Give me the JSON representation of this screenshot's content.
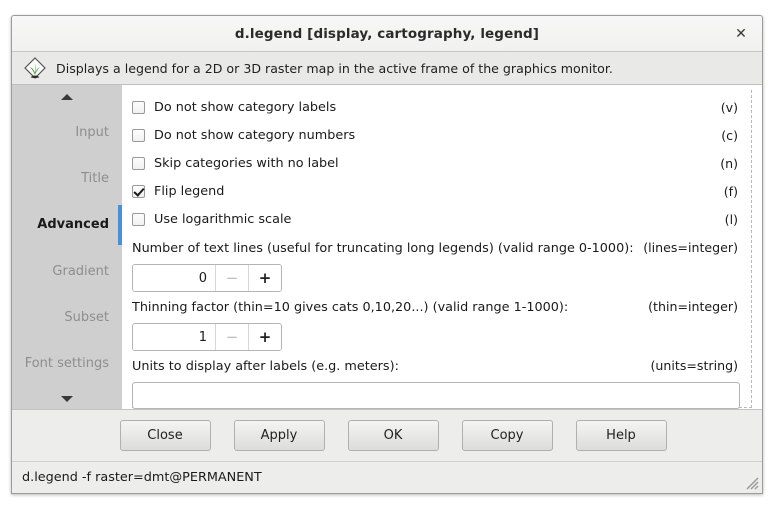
{
  "window": {
    "title": "d.legend [display, cartography, legend]",
    "close_label": "✕",
    "description": "Displays a legend for a 2D or 3D raster map in the active frame of the graphics monitor.",
    "logo_icon": "grass-gis-logo-icon"
  },
  "sidebar": {
    "scroll_up_icon": "chevron-up-icon",
    "scroll_down_icon": "chevron-down-icon",
    "selected": "Advanced",
    "accent_color": "#4a90d9",
    "items": [
      {
        "label": "Input",
        "selected": false
      },
      {
        "label": "Title",
        "selected": false
      },
      {
        "label": "Advanced",
        "selected": true
      },
      {
        "label": "Gradient",
        "selected": false
      },
      {
        "label": "Subset",
        "selected": false
      },
      {
        "label": "Font settings",
        "selected": false
      }
    ]
  },
  "advanced": {
    "checkboxes": [
      {
        "label": "Do not show category labels",
        "hint": "(v)",
        "checked": false
      },
      {
        "label": "Do not show category numbers",
        "hint": "(c)",
        "checked": false
      },
      {
        "label": "Skip categories with no label",
        "hint": "(n)",
        "checked": false
      },
      {
        "label": "Flip legend",
        "hint": "(f)",
        "checked": true
      },
      {
        "label": "Use logarithmic scale",
        "hint": "(l)",
        "checked": false
      }
    ],
    "lines": {
      "label": "Number of text lines (useful for truncating long legends) (valid range 0-1000):",
      "hint": "(lines=integer)",
      "value": "0",
      "decrement_label": "−",
      "increment_label": "+"
    },
    "thin": {
      "label": "Thinning factor (thin=10 gives cats 0,10,20...) (valid range 1-1000):",
      "hint": "(thin=integer)",
      "value": "1",
      "decrement_label": "−",
      "increment_label": "+"
    },
    "units": {
      "label": "Units to display after labels (e.g. meters):",
      "hint": "(units=string)",
      "value": "",
      "placeholder": ""
    }
  },
  "buttons": [
    {
      "label": "Close"
    },
    {
      "label": "Apply"
    },
    {
      "label": "OK"
    },
    {
      "label": "Copy"
    },
    {
      "label": "Help"
    }
  ],
  "statusbar": {
    "command": "d.legend -f raster=dmt@PERMANENT",
    "resize_grip_icon": "resize-grip-icon"
  }
}
